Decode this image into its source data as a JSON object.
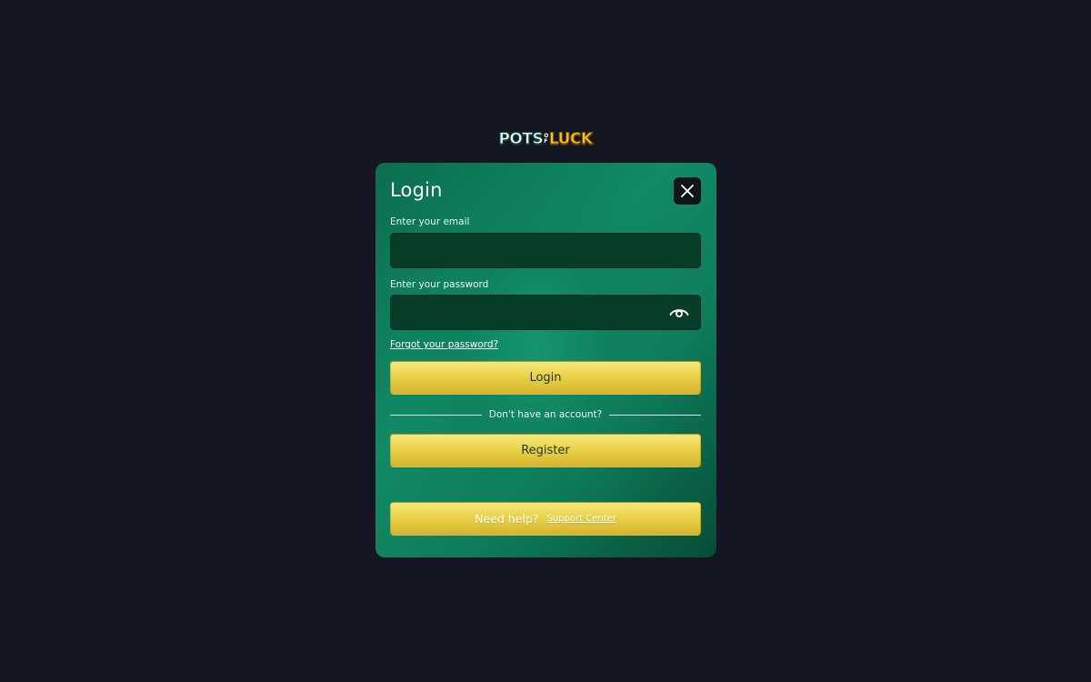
{
  "logo": {
    "part1": "POTS",
    "of_top": "O",
    "of_bottom": "F",
    "part2": "LUCK"
  },
  "modal": {
    "title": "Login",
    "close_icon": "close-icon"
  },
  "email": {
    "label": "Enter your email",
    "value": "",
    "placeholder": ""
  },
  "password": {
    "label": "Enter your password",
    "value": "",
    "placeholder": "",
    "toggle_icon": "eye-icon"
  },
  "forgot_password": "Forgot your password?",
  "login_button": "Login",
  "divider_text": "Don't have an account?",
  "register_button": "Register",
  "help": {
    "text": "Need help?",
    "link": "Support Center"
  },
  "colors": {
    "page_background": "#141723",
    "modal_green": "#0f7d5c",
    "input_background": "#053d27",
    "button_gold": "#ebd24a",
    "close_button": "#0f1518"
  }
}
